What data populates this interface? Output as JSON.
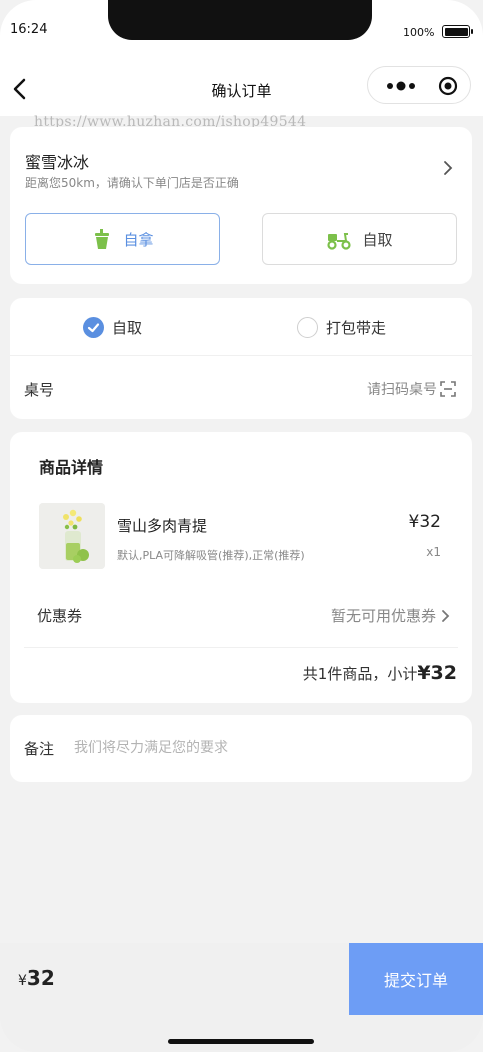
{
  "status_bar": {
    "time": "16:24",
    "battery": "100%"
  },
  "nav": {
    "title": "确认订单"
  },
  "watermark": "https://www.huzhan.com/ishop49544",
  "store": {
    "name": "蜜雪冰冰",
    "hint": "距离您50km，请确认下单门店是否正确",
    "modes": [
      {
        "label": "自拿",
        "active": true
      },
      {
        "label": "自取",
        "active": false
      }
    ]
  },
  "pickup": {
    "options": [
      {
        "label": "自取",
        "checked": true
      },
      {
        "label": "打包带走",
        "checked": false
      }
    ],
    "table_label": "桌号",
    "table_action": "请扫码桌号"
  },
  "goods": {
    "section_title": "商品详情",
    "items": [
      {
        "name": "雪山多肉青提",
        "spec": "默认,PLA可降解吸管(推荐),正常(推荐)",
        "price": "¥32",
        "qty": "x1"
      }
    ],
    "coupon_label": "优惠券",
    "coupon_value": "暂无可用优惠券",
    "subtotal_prefix": "共1件商品，小计",
    "subtotal_amount": "¥32"
  },
  "note": {
    "label": "备注",
    "placeholder": "我们将尽力满足您的要求"
  },
  "footer": {
    "currency": "¥",
    "total": "32",
    "submit_label": "提交订单"
  },
  "colors": {
    "accent": "#5a8fe0",
    "submit": "#6d9df5",
    "green": "#7cc04a"
  }
}
